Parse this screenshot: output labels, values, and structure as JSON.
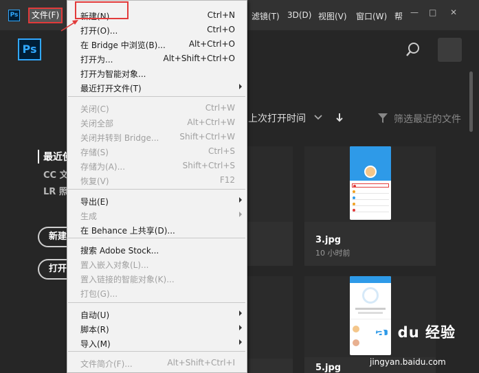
{
  "menubar": {
    "app_badge": "Ps",
    "file_menu": "文件(F)",
    "items": [
      {
        "label": "滤镜(T)"
      },
      {
        "label": "3D(D)"
      },
      {
        "label": "视图(V)"
      },
      {
        "label": "窗口(W)"
      },
      {
        "label": "帮"
      }
    ],
    "window_controls": {
      "minimize": "—",
      "maximize": "□",
      "close": "✕"
    }
  },
  "header": {
    "logo": "Ps",
    "icons": {
      "search": "search-icon",
      "avatar": "avatar"
    }
  },
  "left_nav": {
    "active": "最近使用项",
    "items": [
      "CC 文件",
      "LR 照片"
    ],
    "buttons": [
      "新建...",
      "打开..."
    ]
  },
  "sort": {
    "label": "上次打开时间",
    "filter_placeholder": "筛选最近的文件"
  },
  "cards": [
    {
      "title": "",
      "subtitle": ""
    },
    {
      "title": "3.jpg",
      "subtitle": "10 小时前"
    },
    {
      "title": "",
      "subtitle": ""
    },
    {
      "title": "5.jpg",
      "subtitle": ""
    }
  ],
  "dropdown": {
    "items": [
      {
        "label": "新建(N)...",
        "shortcut": "Ctrl+N",
        "disabled": false,
        "sub": false
      },
      {
        "label": "打开(O)...",
        "shortcut": "Ctrl+O",
        "disabled": false,
        "sub": false
      },
      {
        "label": "在 Bridge 中浏览(B)...",
        "shortcut": "Alt+Ctrl+O",
        "disabled": false,
        "sub": false
      },
      {
        "label": "打开为...",
        "shortcut": "Alt+Shift+Ctrl+O",
        "disabled": false,
        "sub": false
      },
      {
        "label": "打开为智能对象...",
        "shortcut": "",
        "disabled": false,
        "sub": false
      },
      {
        "label": "最近打开文件(T)",
        "shortcut": "",
        "disabled": false,
        "sub": true
      },
      {
        "label": "关闭(C)",
        "shortcut": "Ctrl+W",
        "disabled": true,
        "sub": false
      },
      {
        "label": "关闭全部",
        "shortcut": "Alt+Ctrl+W",
        "disabled": true,
        "sub": false
      },
      {
        "label": "关闭并转到 Bridge...",
        "shortcut": "Shift+Ctrl+W",
        "disabled": true,
        "sub": false
      },
      {
        "label": "存储(S)",
        "shortcut": "Ctrl+S",
        "disabled": true,
        "sub": false
      },
      {
        "label": "存储为(A)...",
        "shortcut": "Shift+Ctrl+S",
        "disabled": true,
        "sub": false
      },
      {
        "label": "恢复(V)",
        "shortcut": "F12",
        "disabled": true,
        "sub": false
      },
      {
        "label": "导出(E)",
        "shortcut": "",
        "disabled": false,
        "sub": true
      },
      {
        "label": "生成",
        "shortcut": "",
        "disabled": true,
        "sub": true
      },
      {
        "label": "在 Behance 上共享(D)...",
        "shortcut": "",
        "disabled": false,
        "sub": false
      },
      {
        "label": "搜索 Adobe Stock...",
        "shortcut": "",
        "disabled": false,
        "sub": false
      },
      {
        "label": "置入嵌入对象(L)...",
        "shortcut": "",
        "disabled": true,
        "sub": false
      },
      {
        "label": "置入链接的智能对象(K)...",
        "shortcut": "",
        "disabled": true,
        "sub": false
      },
      {
        "label": "打包(G)...",
        "shortcut": "",
        "disabled": true,
        "sub": false
      },
      {
        "label": "自动(U)",
        "shortcut": "",
        "disabled": false,
        "sub": true
      },
      {
        "label": "脚本(R)",
        "shortcut": "",
        "disabled": false,
        "sub": true
      },
      {
        "label": "导入(M)",
        "shortcut": "",
        "disabled": false,
        "sub": true
      },
      {
        "label": "文件简介(F)...",
        "shortcut": "Alt+Shift+Ctrl+I",
        "disabled": true,
        "sub": false
      }
    ]
  },
  "watermark": {
    "logo": "Bai du 经验",
    "url": "jingyan.baidu.com"
  },
  "colors": {
    "accent": "#31a8ff",
    "highlight_red": "#e23a3a",
    "menu_bg": "#f2f2f2"
  }
}
